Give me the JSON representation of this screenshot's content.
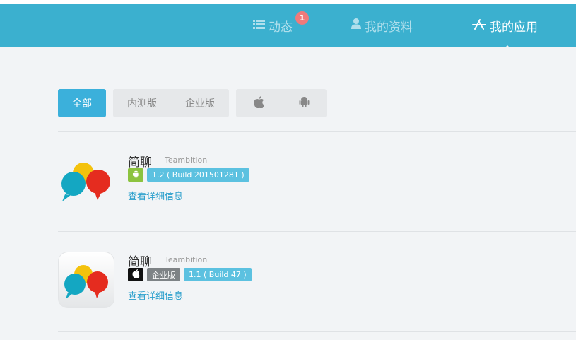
{
  "nav": {
    "feed_label": "动态",
    "feed_badge": "1",
    "profile_label": "我的资料",
    "apps_label": "我的应用"
  },
  "filters": {
    "all": "全部",
    "beta": "内测版",
    "enterprise": "企业版",
    "ios_icon": "apple-icon",
    "android_icon": "android-icon"
  },
  "apps": [
    {
      "name": "简聊",
      "developer": "Teambition",
      "platform": "android",
      "tags": [
        "1.2 ( Build 201501281 )"
      ],
      "details_link": "查看详细信息"
    },
    {
      "name": "简聊",
      "developer": "Teambition",
      "platform": "ios",
      "tags": [
        "企业版",
        "1.1 ( Build 47 )"
      ],
      "details_link": "查看详细信息"
    }
  ],
  "colors": {
    "header": "#3bb0cf",
    "accent": "#3bb0db",
    "badge": "#f07a7a",
    "android": "#8cc33f",
    "link": "#2a9fcc"
  }
}
